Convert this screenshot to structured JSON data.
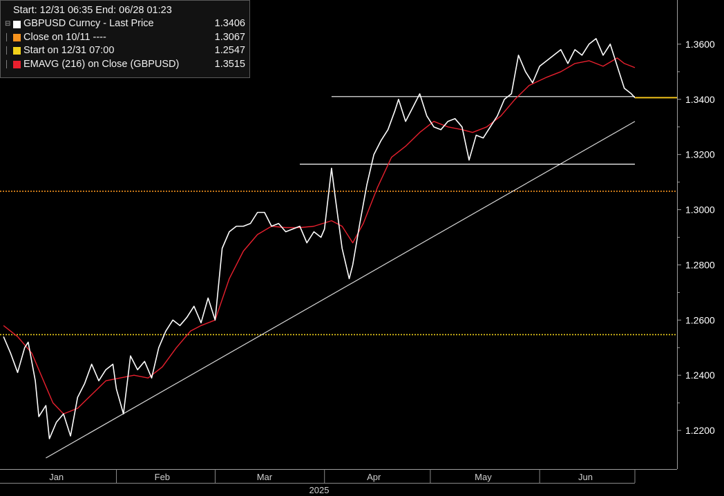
{
  "legend": {
    "header": "Start: 12/31 06:35 End: 06/28 01:23",
    "items": [
      {
        "label": "GBPUSD Curncy - Last Price",
        "value": "1.3406",
        "color": "#ffffff"
      },
      {
        "label": "Close on 10/11 ----",
        "value": "1.3067",
        "color": "#f7931e"
      },
      {
        "label": "Start on 12/31 07:00",
        "value": "1.2547",
        "color": "#f2d21b"
      },
      {
        "label": "EMAVG (216)  on Close (GBPUSD)",
        "value": "1.3515",
        "color": "#e8202e"
      }
    ]
  },
  "chart_data": {
    "type": "line",
    "title": "",
    "xlabel": "2025",
    "ylabel": "",
    "x_tick_labels": [
      "Jan",
      "Feb",
      "Mar",
      "Apr",
      "May",
      "Jun"
    ],
    "y_ticks": [
      "1.2200",
      "1.2400",
      "1.2600",
      "1.2800",
      "1.3000",
      "1.3200",
      "1.3400",
      "1.3600"
    ],
    "ylim": [
      1.206,
      1.376
    ],
    "grid": false,
    "series": [
      {
        "name": "GBPUSD Curncy - Last Price",
        "color": "#ffffff",
        "x": [
          "2024-12-31",
          "2025-01-02",
          "2025-01-04",
          "2025-01-06",
          "2025-01-07",
          "2025-01-09",
          "2025-01-10",
          "2025-01-12",
          "2025-01-13",
          "2025-01-15",
          "2025-01-17",
          "2025-01-19",
          "2025-01-21",
          "2025-01-23",
          "2025-01-25",
          "2025-01-27",
          "2025-01-29",
          "2025-01-31",
          "2025-02-01",
          "2025-02-03",
          "2025-02-05",
          "2025-02-07",
          "2025-02-09",
          "2025-02-11",
          "2025-02-13",
          "2025-02-15",
          "2025-02-17",
          "2025-02-19",
          "2025-02-21",
          "2025-02-23",
          "2025-02-25",
          "2025-02-27",
          "2025-03-01",
          "2025-03-03",
          "2025-03-05",
          "2025-03-07",
          "2025-03-09",
          "2025-03-11",
          "2025-03-13",
          "2025-03-15",
          "2025-03-17",
          "2025-03-19",
          "2025-03-21",
          "2025-03-23",
          "2025-03-25",
          "2025-03-27",
          "2025-03-29",
          "2025-03-31",
          "2025-04-01",
          "2025-04-03",
          "2025-04-04",
          "2025-04-06",
          "2025-04-08",
          "2025-04-09",
          "2025-04-11",
          "2025-04-13",
          "2025-04-15",
          "2025-04-17",
          "2025-04-19",
          "2025-04-21",
          "2025-04-22",
          "2025-04-24",
          "2025-04-26",
          "2025-04-28",
          "2025-04-30",
          "2025-05-02",
          "2025-05-04",
          "2025-05-06",
          "2025-05-08",
          "2025-05-10",
          "2025-05-12",
          "2025-05-14",
          "2025-05-16",
          "2025-05-18",
          "2025-05-20",
          "2025-05-22",
          "2025-05-24",
          "2025-05-26",
          "2025-05-28",
          "2025-05-30",
          "2025-06-01",
          "2025-06-03",
          "2025-06-05",
          "2025-06-07",
          "2025-06-09",
          "2025-06-11",
          "2025-06-13",
          "2025-06-15",
          "2025-06-17",
          "2025-06-19",
          "2025-06-21",
          "2025-06-23",
          "2025-06-25",
          "2025-06-27",
          "2025-06-28"
        ],
        "values": [
          1.254,
          1.248,
          1.241,
          1.25,
          1.252,
          1.238,
          1.225,
          1.229,
          1.217,
          1.223,
          1.226,
          1.218,
          1.232,
          1.237,
          1.244,
          1.238,
          1.242,
          1.244,
          1.235,
          1.226,
          1.247,
          1.242,
          1.245,
          1.239,
          1.25,
          1.256,
          1.26,
          1.258,
          1.261,
          1.265,
          1.259,
          1.268,
          1.26,
          1.286,
          1.292,
          1.294,
          1.294,
          1.295,
          1.299,
          1.299,
          1.294,
          1.295,
          1.292,
          1.293,
          1.294,
          1.288,
          1.292,
          1.29,
          1.293,
          1.315,
          1.305,
          1.286,
          1.275,
          1.28,
          1.295,
          1.309,
          1.32,
          1.325,
          1.329,
          1.336,
          1.34,
          1.332,
          1.337,
          1.342,
          1.334,
          1.33,
          1.329,
          1.332,
          1.333,
          1.33,
          1.318,
          1.327,
          1.326,
          1.33,
          1.334,
          1.34,
          1.342,
          1.356,
          1.35,
          1.346,
          1.352,
          1.354,
          1.356,
          1.358,
          1.353,
          1.358,
          1.356,
          1.36,
          1.362,
          1.356,
          1.36,
          1.352,
          1.344,
          1.342,
          1.3406
        ]
      },
      {
        "name": "EMAVG (216)  on Close (GBPUSD)",
        "color": "#e8202e",
        "x": [
          "2024-12-31",
          "2025-01-04",
          "2025-01-08",
          "2025-01-12",
          "2025-01-14",
          "2025-01-17",
          "2025-01-21",
          "2025-01-25",
          "2025-01-29",
          "2025-02-02",
          "2025-02-06",
          "2025-02-10",
          "2025-02-14",
          "2025-02-18",
          "2025-02-22",
          "2025-02-25",
          "2025-03-01",
          "2025-03-05",
          "2025-03-09",
          "2025-03-13",
          "2025-03-17",
          "2025-03-21",
          "2025-03-25",
          "2025-03-29",
          "2025-04-03",
          "2025-04-06",
          "2025-04-09",
          "2025-04-12",
          "2025-04-16",
          "2025-04-20",
          "2025-04-24",
          "2025-04-28",
          "2025-05-02",
          "2025-05-06",
          "2025-05-10",
          "2025-05-13",
          "2025-05-17",
          "2025-05-21",
          "2025-05-25",
          "2025-05-29",
          "2025-06-03",
          "2025-06-07",
          "2025-06-11",
          "2025-06-15",
          "2025-06-19",
          "2025-06-23",
          "2025-06-25",
          "2025-06-28"
        ],
        "values": [
          1.258,
          1.254,
          1.248,
          1.236,
          1.23,
          1.226,
          1.228,
          1.233,
          1.238,
          1.239,
          1.24,
          1.239,
          1.243,
          1.25,
          1.256,
          1.258,
          1.26,
          1.275,
          1.285,
          1.291,
          1.294,
          1.2935,
          1.2935,
          1.294,
          1.296,
          1.294,
          1.288,
          1.295,
          1.308,
          1.319,
          1.323,
          1.328,
          1.332,
          1.33,
          1.329,
          1.328,
          1.33,
          1.334,
          1.34,
          1.345,
          1.348,
          1.35,
          1.353,
          1.354,
          1.352,
          1.355,
          1.353,
          1.3515
        ]
      }
    ],
    "reference_lines": [
      {
        "label": "Close on 10/11 ----",
        "value": 1.3067,
        "color": "#f7931e",
        "style": "dotted"
      },
      {
        "label": "Start on 12/31 07:00",
        "value": 1.2547,
        "color": "#f2d21b",
        "style": "dotted"
      }
    ],
    "annotations": [
      {
        "type": "trendline",
        "from": [
          "2025-01-12",
          1.21
        ],
        "to": [
          "2025-06-28",
          1.332
        ],
        "color": "#d8d8d8"
      },
      {
        "type": "hline",
        "from": [
          "2025-03-25",
          1.3165
        ],
        "to": [
          "2025-06-28",
          1.3165
        ],
        "color": "#ffffff"
      },
      {
        "type": "hline",
        "from": [
          "2025-04-03",
          1.341
        ],
        "to": [
          "2025-06-28",
          1.341
        ],
        "color": "#ffffff"
      }
    ]
  }
}
